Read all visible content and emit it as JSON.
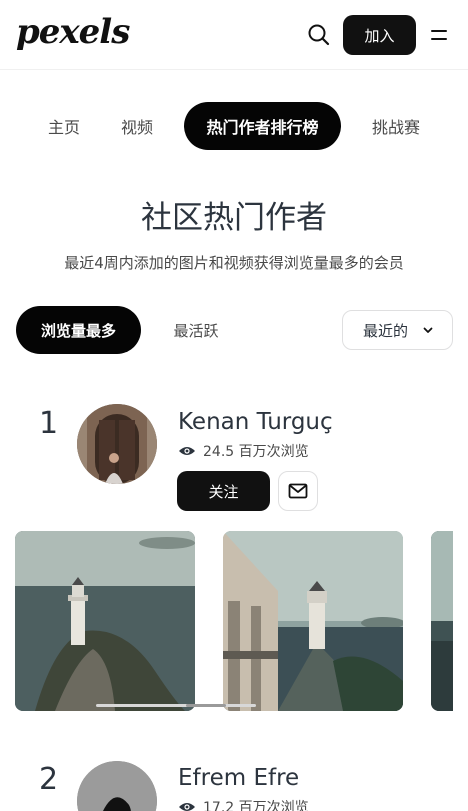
{
  "header": {
    "logo": "pexels",
    "join_label": "加入"
  },
  "nav": {
    "tabs": [
      {
        "label": "主页"
      },
      {
        "label": "视频"
      },
      {
        "label": "热门作者排行榜"
      },
      {
        "label": "挑战赛"
      }
    ],
    "active_index": 2
  },
  "page": {
    "title": "社区热门作者",
    "subtitle": "最近4周内添加的图片和视频获得浏览量最多的会员"
  },
  "filters": {
    "most_views": "浏览量最多",
    "most_active": "最活跃",
    "sort_selected": "最近的"
  },
  "authors": [
    {
      "rank": "1",
      "name": "Kenan Turguç",
      "views": "24.5 百万次浏览",
      "follow_label": "关注"
    },
    {
      "rank": "2",
      "name": "Efrem Efre",
      "views": "17.2 百万次浏览"
    }
  ],
  "colors": {
    "primary": "#050505",
    "text": "#2c343e",
    "muted": "#4a4a4a",
    "border": "#dfdfe0"
  },
  "icons": [
    "search-icon",
    "menu-icon",
    "chevron-down-icon",
    "eye-icon",
    "mail-icon"
  ]
}
